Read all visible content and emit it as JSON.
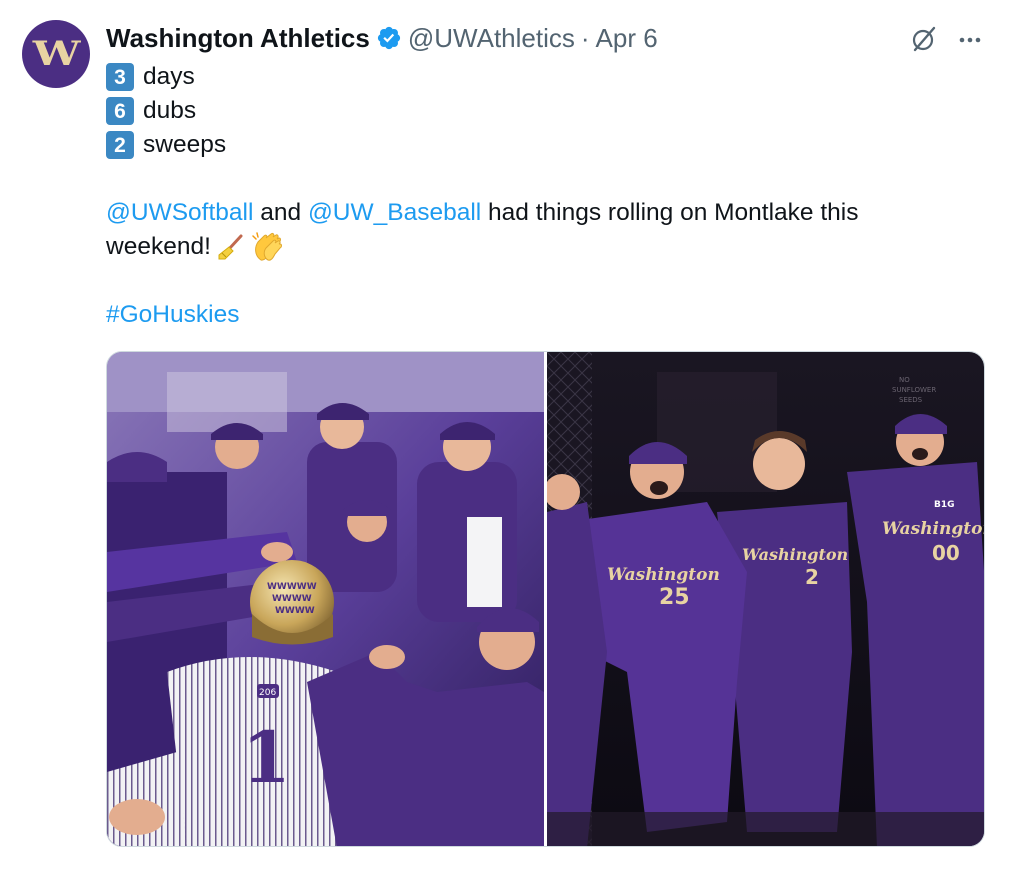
{
  "author": {
    "display_name": "Washington Athletics",
    "handle": "@UWAthletics",
    "separator": "·",
    "date": "Apr 6",
    "avatar_letter": "W",
    "verified_icon": "verified-badge-icon"
  },
  "actions": {
    "grok_icon": "grok-icon",
    "more_icon": "more-icon"
  },
  "tweet": {
    "lines": [
      {
        "num": "3",
        "word": "days"
      },
      {
        "num": "6",
        "word": "dubs"
      },
      {
        "num": "2",
        "word": "sweeps"
      }
    ],
    "mention_1": "@UWSoftball",
    "connector": "and",
    "mention_2": "@UW_Baseball",
    "sentence_rest": "had things rolling on Montlake this",
    "sentence_end": "weekend!",
    "emojis": [
      "broom-emoji",
      "clapping-hands-emoji"
    ],
    "hashtag": "#GoHuskies"
  },
  "media": {
    "photos": [
      {
        "kind": "baseball-dugout-celebration-photo",
        "helmet_text": [
          "WWWWW",
          "WWWW",
          "WWWW"
        ],
        "jersey_number": "1",
        "sleeve_patch": "206"
      },
      {
        "kind": "softball-team-celebration-photo",
        "jersey_script": "Washington",
        "jersey_numbers": [
          "25",
          "2",
          "00"
        ],
        "conference_logo": "B1G"
      }
    ]
  },
  "colors": {
    "link": "#1d9bf0",
    "muted": "#536471",
    "text": "#0f1419",
    "husky_purple": "#4b2e83",
    "husky_gold": "#e8d3a2",
    "keycap_blue": "#3b88c3"
  }
}
